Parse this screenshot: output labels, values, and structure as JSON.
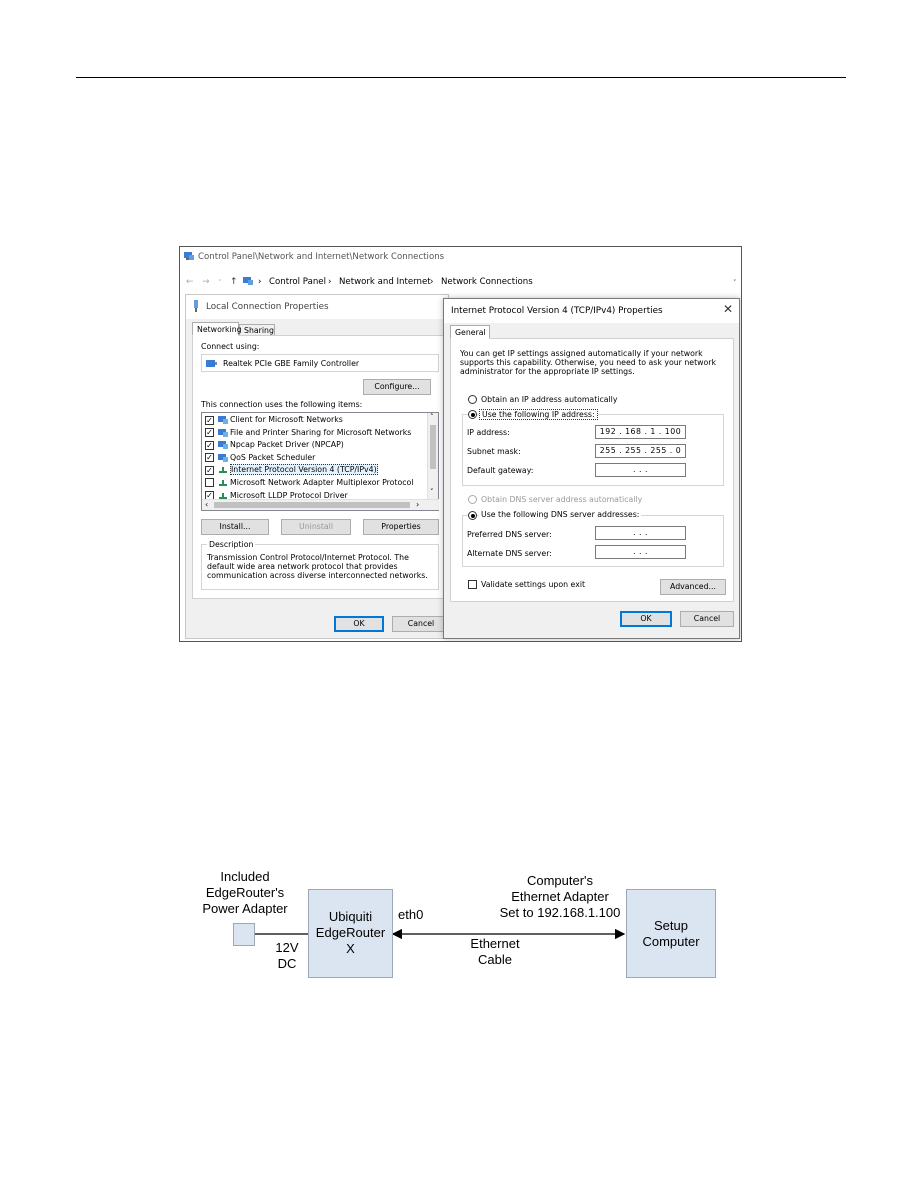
{
  "explorer": {
    "title": "Control Panel\\Network and Internet\\Network Connections",
    "breadcrumb": [
      "Control Panel",
      "Network and Internet",
      "Network Connections"
    ]
  },
  "lcp": {
    "title": "Local Connection Properties",
    "tabs": [
      "Networking",
      "Sharing"
    ],
    "connect_using_label": "Connect using:",
    "adapter": "Realtek PCIe GBE Family Controller",
    "configure_btn": "Configure...",
    "items_label": "This connection uses the following items:",
    "items": [
      {
        "label": "Client for Microsoft Networks",
        "checked": true
      },
      {
        "label": "File and Printer Sharing for Microsoft Networks",
        "checked": true
      },
      {
        "label": "Npcap Packet Driver (NPCAP)",
        "checked": true
      },
      {
        "label": "QoS Packet Scheduler",
        "checked": true
      },
      {
        "label": "Internet Protocol Version 4 (TCP/IPv4)",
        "checked": true
      },
      {
        "label": "Microsoft Network Adapter Multiplexor Protocol",
        "checked": false
      },
      {
        "label": "Microsoft LLDP Protocol Driver",
        "checked": true
      }
    ],
    "install_btn": "Install...",
    "uninstall_btn": "Uninstall",
    "properties_btn": "Properties",
    "description_label": "Description",
    "description": "Transmission Control Protocol/Internet Protocol. The default wide area network protocol that provides communication across diverse interconnected networks.",
    "ok_btn": "OK",
    "cancel_btn": "Cancel"
  },
  "ipv4": {
    "title": "Internet Protocol Version 4 (TCP/IPv4) Properties",
    "tab": "General",
    "intro": "You can get IP settings assigned automatically if your network supports this capability. Otherwise, you need to ask your network administrator for the appropriate IP settings.",
    "auto_ip": "Obtain an IP address automatically",
    "use_ip": "Use the following IP address:",
    "ip_label": "IP address:",
    "ip_value": "192 . 168 .  1  . 100",
    "mask_label": "Subnet mask:",
    "mask_value": "255 . 255 . 255 .  0",
    "gateway_label": "Default gateway:",
    "gateway_value": ".       .       .",
    "auto_dns": "Obtain DNS server address automatically",
    "use_dns": "Use the following DNS server addresses:",
    "pref_dns_label": "Preferred DNS server:",
    "pref_dns_value": ".       .       .",
    "alt_dns_label": "Alternate DNS server:",
    "alt_dns_value": ".       .       .",
    "validate": "Validate settings upon exit",
    "advanced_btn": "Advanced...",
    "ok_btn": "OK",
    "cancel_btn": "Cancel"
  },
  "diagram": {
    "power_label": [
      "Included",
      "EdgeRouter's",
      "Power Adapter"
    ],
    "dc_label": [
      "12V",
      "DC"
    ],
    "router_label": [
      "Ubiquiti",
      "EdgeRouter",
      "X"
    ],
    "eth0_label": "eth0",
    "adapter_label": [
      "Computer's",
      "Ethernet Adapter",
      "Set to 192.168.1.100"
    ],
    "cable_label": [
      "Ethernet",
      "Cable"
    ],
    "computer_label": [
      "Setup",
      "Computer"
    ],
    "box_color": "#dbe5f1"
  }
}
